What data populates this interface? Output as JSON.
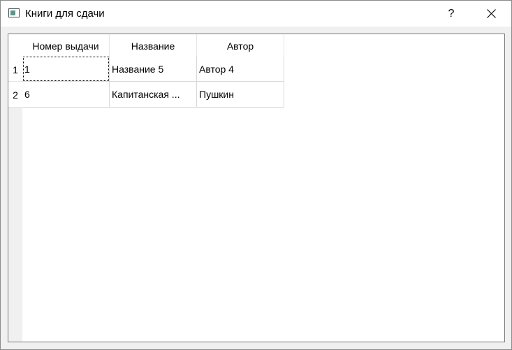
{
  "window": {
    "title": "Книги для сдачи",
    "help_label": "?"
  },
  "table": {
    "columns": [
      "Номер выдачи",
      "Название",
      "Автор"
    ],
    "rows": [
      {
        "header": "1",
        "cells": [
          "1",
          "Название 5",
          "Автор 4"
        ]
      },
      {
        "header": "2",
        "cells": [
          "6",
          "Капитанская ...",
          "Пушкин"
        ]
      }
    ],
    "focused_cell": {
      "row": 1,
      "column": 1
    }
  }
}
